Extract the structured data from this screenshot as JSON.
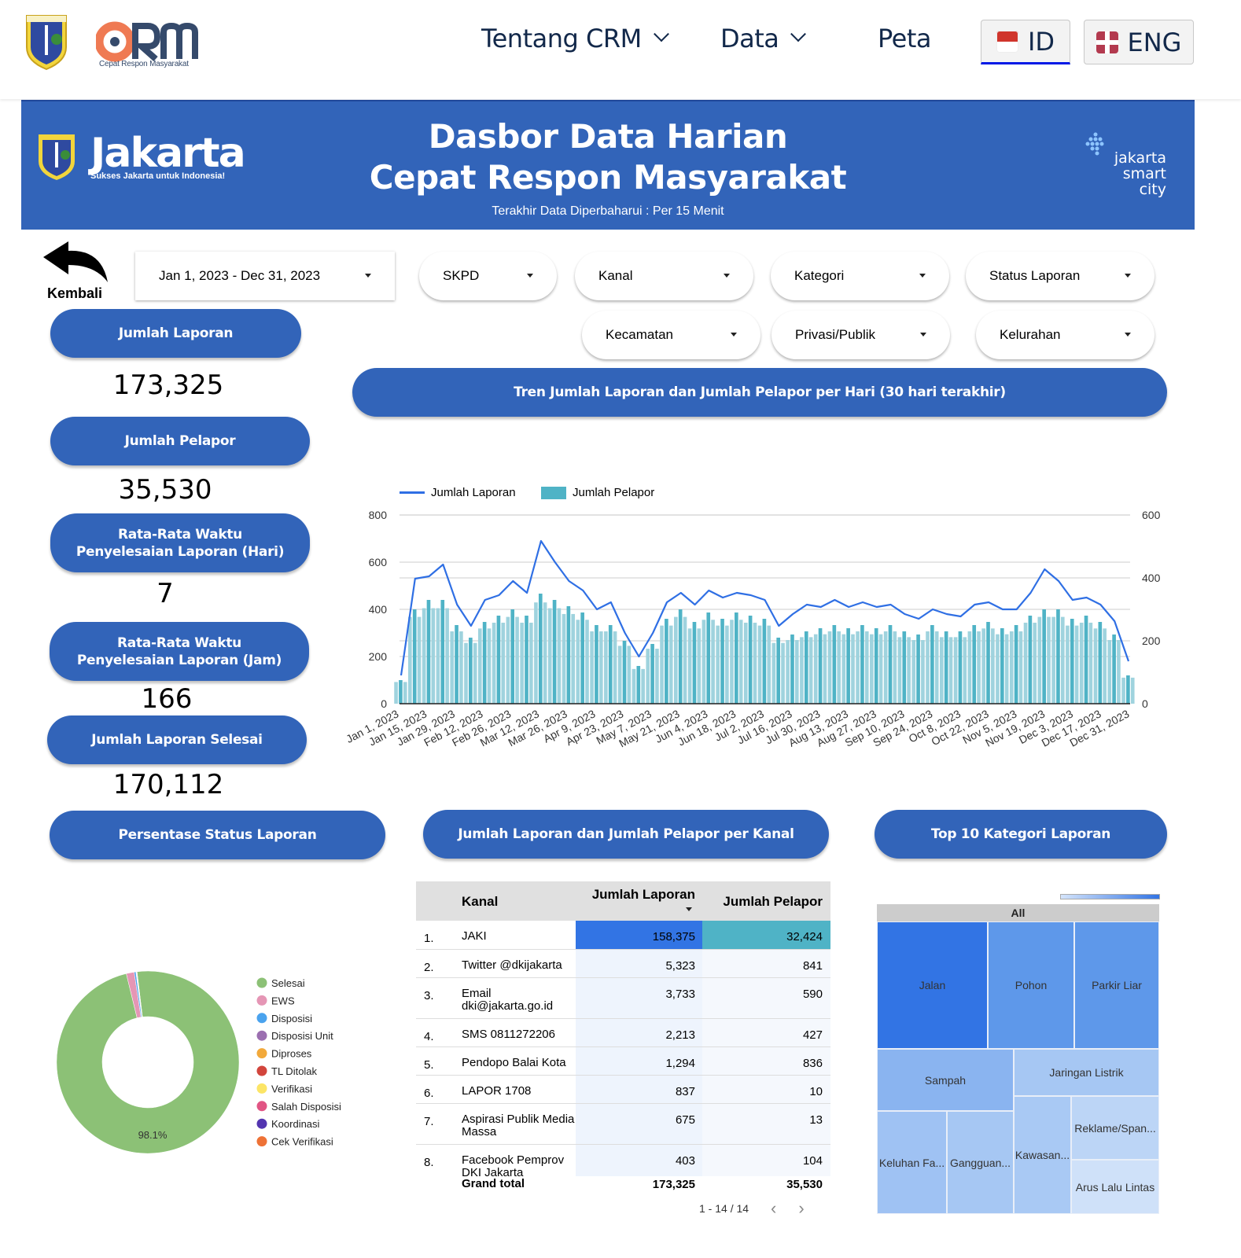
{
  "nav": {
    "logo_alt": "CRM",
    "logo_subtitle": "Cepat Respon Masyarakat",
    "items": [
      {
        "label": "Tentang CRM",
        "has_dropdown": true
      },
      {
        "label": "Data",
        "has_dropdown": true
      },
      {
        "label": "Peta",
        "has_dropdown": false
      }
    ],
    "languages": [
      {
        "label": "ID",
        "flag": "indonesia-flag-icon",
        "active": true
      },
      {
        "label": "ENG",
        "flag": "uk-flag-icon",
        "active": false
      }
    ]
  },
  "banner": {
    "brand": "Jakarta",
    "slogan": "Sukses Jakarta untuk Indonesia!",
    "title_line1": "Dasbor Data Harian",
    "title_line2": "Cepat Respon Masyarakat",
    "subtitle": "Terakhir Data Diperbaharui : Per 15 Menit",
    "smart_city_line1": "jakarta",
    "smart_city_line2": "smart",
    "smart_city_line3": "city",
    "color": "#3264b9"
  },
  "back": {
    "label": "Kembali"
  },
  "filters": {
    "date_range": "Jan 1, 2023 - Dec 31, 2023",
    "dropdowns": [
      "SKPD",
      "Kanal",
      "Kategori",
      "Status Laporan",
      "Kecamatan",
      "Privasi/Publik",
      "Kelurahan"
    ]
  },
  "kpis": [
    {
      "label": "Jumlah Laporan",
      "value": "173,325"
    },
    {
      "label": "Jumlah Pelapor",
      "value": "35,530"
    },
    {
      "label": "Rata-Rata Waktu Penyelesaian Laporan (Hari)",
      "value": "7"
    },
    {
      "label": "Rata-Rata Waktu Penyelesaian Laporan (Jam)",
      "value": "166"
    },
    {
      "label": "Jumlah Laporan Selesai",
      "value": "170,112"
    }
  ],
  "sections": {
    "trend": "Tren Jumlah Laporan dan Jumlah Pelapor per Hari (30 hari terakhir)",
    "status": "Persentase Status Laporan",
    "kanal": "Jumlah Laporan dan Jumlah Pelapor per Kanal",
    "kategori": "Top 10 Kategori Laporan"
  },
  "chart_data": [
    {
      "type": "line+bar",
      "title": "Tren Jumlah Laporan dan Jumlah Pelapor per Hari (30 hari terakhir)",
      "legend": [
        "Jumlah Laporan",
        "Jumlah Pelapor"
      ],
      "legend_position": "top-left",
      "grid": true,
      "x_tick_labels": [
        "Jan 1, 2023",
        "Jan 15, 2023",
        "Jan 29, 2023",
        "Feb 12, 2023",
        "Feb 26, 2023",
        "Mar 12, 2023",
        "Mar 26, 2023",
        "Apr 9, 2023",
        "Apr 23, 2023",
        "May 7, 2023",
        "May 21, 2023",
        "Jun 4, 2023",
        "Jun 18, 2023",
        "Jul 2, 2023",
        "Jul 16, 2023",
        "Jul 30, 2023",
        "Aug 13, 2023",
        "Aug 27, 2023",
        "Sep 10, 2023",
        "Sep 24, 2023",
        "Oct 8, 2023",
        "Oct 22, 2023",
        "Nov 5, 2023",
        "Nov 19, 2023",
        "Dec 3, 2023",
        "Dec 17, 2023",
        "Dec 31, 2023"
      ],
      "x_sample_note": "weekly samples starting Jan 1, 2023",
      "left_axis": {
        "label": "Jumlah Laporan",
        "ylim": [
          0,
          800
        ],
        "ticks": [
          0,
          200,
          400,
          600,
          800
        ]
      },
      "right_axis": {
        "label": "Jumlah Pelapor",
        "ylim": [
          0,
          600
        ],
        "ticks": [
          0,
          200,
          400,
          600
        ]
      },
      "series": [
        {
          "name": "Jumlah Laporan",
          "axis": "left",
          "type": "line",
          "color": "#2f6fe4",
          "values": [
            120,
            530,
            540,
            590,
            420,
            330,
            440,
            460,
            520,
            470,
            690,
            600,
            520,
            480,
            400,
            430,
            300,
            200,
            300,
            430,
            470,
            420,
            480,
            450,
            470,
            460,
            440,
            330,
            380,
            420,
            410,
            440,
            410,
            430,
            410,
            420,
            380,
            360,
            400,
            380,
            370,
            420,
            430,
            400,
            400,
            470,
            570,
            520,
            440,
            450,
            420,
            350,
            180
          ]
        },
        {
          "name": "Jumlah Pelapor",
          "axis": "right",
          "type": "bar",
          "color": "#4fb3c6",
          "values": [
            75,
            300,
            330,
            330,
            250,
            210,
            260,
            280,
            300,
            280,
            350,
            330,
            310,
            290,
            250,
            250,
            200,
            120,
            190,
            270,
            300,
            260,
            290,
            270,
            290,
            280,
            270,
            210,
            220,
            230,
            240,
            250,
            240,
            250,
            240,
            250,
            230,
            220,
            250,
            230,
            230,
            250,
            260,
            240,
            250,
            280,
            300,
            300,
            270,
            280,
            260,
            220,
            90
          ]
        }
      ]
    },
    {
      "type": "pie",
      "title": "Persentase Status Laporan",
      "style": "donut",
      "legend_position": "right",
      "slices": [
        {
          "label": "Selesai",
          "value": 98.1,
          "color": "#8cc176"
        },
        {
          "label": "EWS",
          "value": 1.4,
          "color": "#e596b5"
        },
        {
          "label": "Disposisi",
          "value": 0.3,
          "color": "#4aa3ee"
        },
        {
          "label": "Disposisi Unit",
          "value": 0.05,
          "color": "#9b6fb0"
        },
        {
          "label": "Diproses",
          "value": 0.05,
          "color": "#f2a93b"
        },
        {
          "label": "TL Ditolak",
          "value": 0.03,
          "color": "#d2453c"
        },
        {
          "label": "Verifikasi",
          "value": 0.02,
          "color": "#fce566"
        },
        {
          "label": "Salah Disposisi",
          "value": 0.02,
          "color": "#e15584"
        },
        {
          "label": "Koordinasi",
          "value": 0.02,
          "color": "#5335b0"
        },
        {
          "label": "Cek Verifikasi",
          "value": 0.01,
          "color": "#ee7236"
        }
      ],
      "data_labels": [
        "98.1%"
      ]
    },
    {
      "type": "table",
      "title": "Jumlah Laporan dan Jumlah Pelapor per Kanal",
      "columns": [
        "",
        "Kanal",
        "Jumlah Laporan",
        "Jumlah Pelapor"
      ],
      "sorted_by": "Jumlah Laporan",
      "rows": [
        {
          "rank": "1.",
          "kanal": "JAKI",
          "laporan": "158,375",
          "pelapor": "32,424"
        },
        {
          "rank": "2.",
          "kanal": "Twitter @dkijakarta",
          "laporan": "5,323",
          "pelapor": "841"
        },
        {
          "rank": "3.",
          "kanal": "Email dki@jakarta.go.id",
          "laporan": "3,733",
          "pelapor": "590"
        },
        {
          "rank": "4.",
          "kanal": "SMS 0811272206",
          "laporan": "2,213",
          "pelapor": "427"
        },
        {
          "rank": "5.",
          "kanal": "Pendopo Balai Kota",
          "laporan": "1,294",
          "pelapor": "836"
        },
        {
          "rank": "6.",
          "kanal": "LAPOR 1708",
          "laporan": "837",
          "pelapor": "10"
        },
        {
          "rank": "7.",
          "kanal": "Aspirasi Publik Media Massa",
          "laporan": "675",
          "pelapor": "13"
        },
        {
          "rank": "8.",
          "kanal": "Facebook Pemprov DKI Jakarta",
          "laporan": "403",
          "pelapor": "104"
        }
      ],
      "grand_total": {
        "label": "Grand total",
        "laporan": "173,325",
        "pelapor": "35,530"
      },
      "pagination": "1 - 14 / 14"
    },
    {
      "type": "treemap",
      "title": "Top 10 Kategori Laporan",
      "root": "All",
      "cells": [
        {
          "label": "Jalan",
          "color": "#3274e4"
        },
        {
          "label": "Pohon",
          "color": "#5e98ea"
        },
        {
          "label": "Parkir Liar",
          "color": "#5e98ea"
        },
        {
          "label": "Sampah",
          "color": "#8ab4f0"
        },
        {
          "label": "Jaringan Listrik",
          "color": "#a6c7f3"
        },
        {
          "label": "Keluhan Fa...",
          "color": "#9fc2f3"
        },
        {
          "label": "Gangguan...",
          "color": "#a6c7f3"
        },
        {
          "label": "Kawasan...",
          "color": "#a9c9f4"
        },
        {
          "label": "Reklame/Span...",
          "color": "#bcd5f6"
        },
        {
          "label": "Arus Lalu Lintas",
          "color": "#cfe1f9"
        }
      ]
    }
  ]
}
